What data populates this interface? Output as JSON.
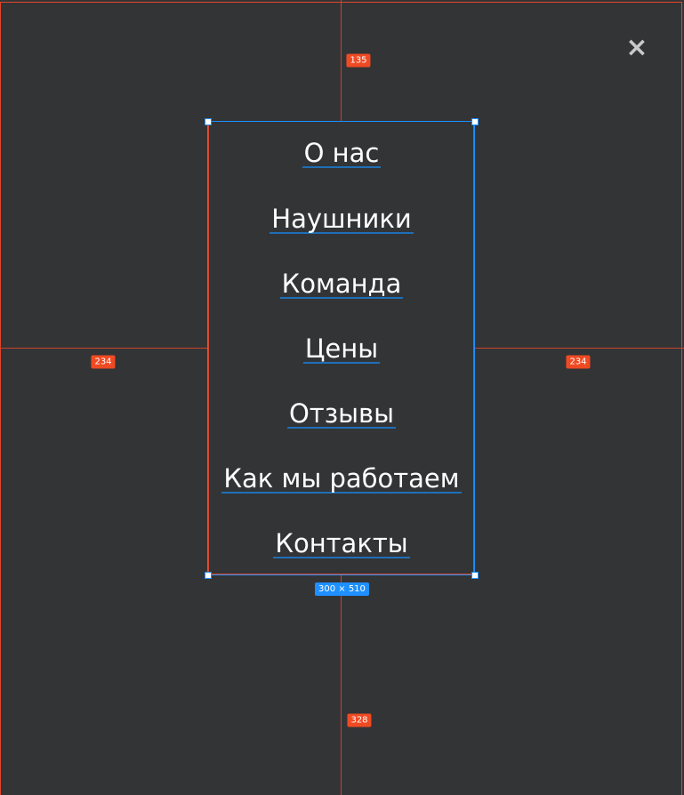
{
  "menu": {
    "items": [
      "О нас",
      "Наушники",
      "Команда",
      "Цены",
      "Отзывы",
      "Как мы работаем",
      "Контакты"
    ]
  },
  "measurements": {
    "top": "135",
    "left": "234",
    "right": "234",
    "bottom": "328",
    "size": "300 × 510"
  },
  "close_icon": "×",
  "colors": {
    "background": "#333436",
    "guide": "#e0452c",
    "selection": "#1e90ff"
  }
}
